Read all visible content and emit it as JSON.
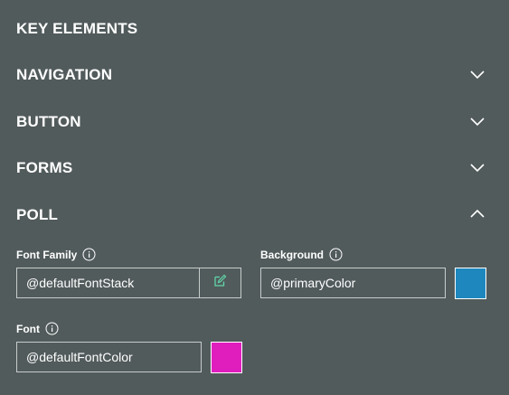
{
  "header": {
    "title": "KEY ELEMENTS"
  },
  "accordion": [
    {
      "label": "NAVIGATION",
      "expanded": false,
      "icon": "chevron-down-icon"
    },
    {
      "label": "BUTTON",
      "expanded": false,
      "icon": "chevron-down-icon"
    },
    {
      "label": "FORMS",
      "expanded": false,
      "icon": "chevron-down-icon"
    },
    {
      "label": "POLL",
      "expanded": true,
      "icon": "chevron-up-icon"
    }
  ],
  "poll": {
    "font_family": {
      "label": "Font Family",
      "value": "@defaultFontStack",
      "icon": "info-icon",
      "edit_icon": "edit-icon"
    },
    "background": {
      "label": "Background",
      "value": "@primaryColor",
      "icon": "info-icon",
      "swatch_color": "#1e88be"
    },
    "font": {
      "label": "Font",
      "value": "@defaultFontColor",
      "icon": "info-icon",
      "swatch_color": "#e01ebe"
    }
  },
  "colors": {
    "background": "#525b5c",
    "text": "#ffffff",
    "border": "#c7cccc",
    "edit_icon": "#5fd6a8"
  }
}
